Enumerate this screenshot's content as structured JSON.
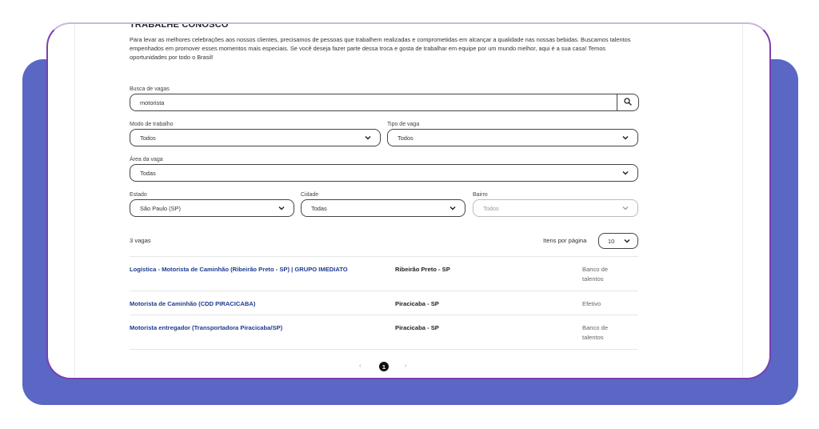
{
  "page": {
    "title": "TRABALHE CONOSCO",
    "intro": "Para levar as melhores celebrações aos nossos clientes, precisamos de pessoas que trabalhem realizadas e comprometidas em alcançar a qualidade nas nossas bebidas. Buscamos talentos empenhados em promover esses momentos mais especiais. Se você deseja fazer parte dessa troca e gosta de trabalhar em equipe por um mundo melhor, aqui é a sua casa! Temos oportunidades por todo o Brasil!"
  },
  "filters": {
    "search_label": "Busca de vagas",
    "search_value": "motorista",
    "work_mode_label": "Modo de trabalho",
    "work_mode_value": "Todos",
    "job_type_label": "Tipo de vaga",
    "job_type_value": "Todos",
    "area_label": "Área da vaga",
    "area_value": "Todas",
    "state_label": "Estado",
    "state_value": "São Paulo (SP)",
    "city_label": "Cidade",
    "city_value": "Todas",
    "district_label": "Bairro",
    "district_value": "Todos"
  },
  "results": {
    "count": "3 vagas",
    "items_per_page_label": "Itens por página",
    "items_per_page_value": "10",
    "jobs": [
      {
        "title": "Logística - Motorista de Caminhão (Ribeirão Preto - SP) | GRUPO IMEDIATO",
        "city": "Ribeirão Preto - SP",
        "type": "Banco de talentos"
      },
      {
        "title": "Motorista de Caminhão (CDD PIRACICABA)",
        "city": "Piracicaba - SP",
        "type": "Efetivo"
      },
      {
        "title": "Motorista entregador (Transportadora Piracicaba/SP)",
        "city": "Piracicaba - SP",
        "type": "Banco de talentos"
      }
    ]
  },
  "pagination": {
    "prev": "‹",
    "current": "1",
    "next": "›"
  },
  "colors": {
    "accent_blue": "#5a67c4",
    "link_blue": "#1d3b8f",
    "card_border": "#7b3fb3"
  },
  "icons": {
    "search": "search-icon",
    "dropdown": "chevron-down-icon"
  }
}
